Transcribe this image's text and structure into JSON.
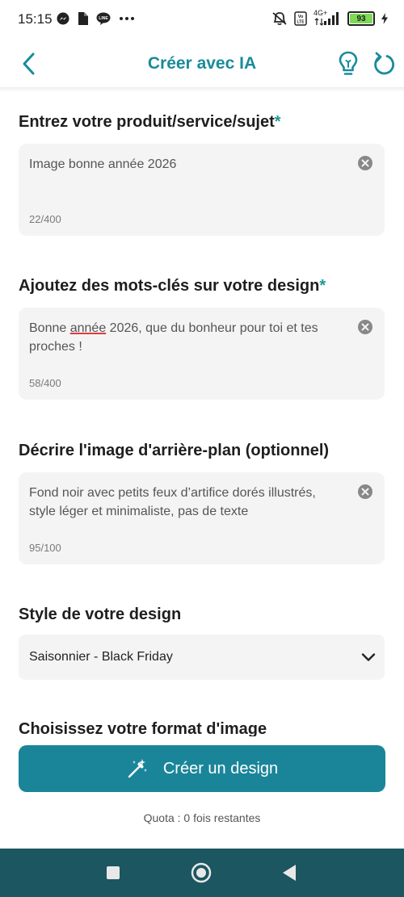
{
  "status_bar": {
    "time": "15:15",
    "network": "4G+",
    "battery": "93"
  },
  "header": {
    "title": "Créer avec IA"
  },
  "sections": {
    "product": {
      "label": "Entrez votre produit/service/sujet",
      "required_mark": "*",
      "value": "Image bonne année 2026",
      "counter": "22/400"
    },
    "keywords": {
      "label": "Ajoutez des mots-clés sur votre design",
      "required_mark": "*",
      "value_before": "Bonne ",
      "value_marked": "année",
      "value_after": " 2026, que du bonheur pour toi et tes proches !",
      "counter": "58/400"
    },
    "background": {
      "label": "Décrire l'image d'arrière-plan (optionnel)",
      "value": "Fond noir avec petits feux d’artifice dorés illustrés, style léger et minimaliste, pas de texte",
      "counter": "95/100"
    },
    "style": {
      "label": "Style de votre design",
      "selected": "Saisonnier - Black Friday"
    },
    "format": {
      "label": "Choisissez votre format d'image"
    }
  },
  "cta": {
    "label": "Créer un design"
  },
  "quota": "Quota : 0 fois restantes",
  "colors": {
    "accent": "#1a8b9a",
    "button": "#1a8599",
    "navbar": "#1c5660",
    "field_bg": "#f4f4f4"
  }
}
